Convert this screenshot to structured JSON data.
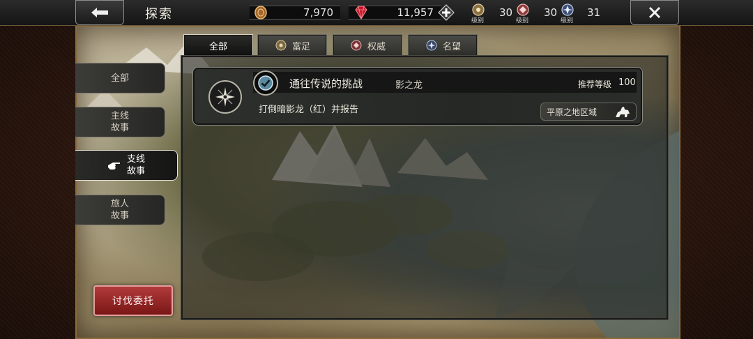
{
  "header": {
    "title": "探索",
    "back_icon": "arrow-left-icon",
    "close_icon": "close-icon"
  },
  "resources": {
    "coins": "7,970",
    "gems": "11,957",
    "add_icon": "plus-icon"
  },
  "ranks": [
    {
      "value": "30",
      "label": "级别",
      "icon": "wealth-emblem-icon"
    },
    {
      "value": "30",
      "label": "级别",
      "icon": "authority-emblem-icon"
    },
    {
      "value": "31",
      "label": "级别",
      "icon": "fame-emblem-icon"
    }
  ],
  "tabs": [
    {
      "label": "全部",
      "active": true
    },
    {
      "label": "富足",
      "icon": "wealth-emblem-icon"
    },
    {
      "label": "权威",
      "icon": "authority-emblem-icon"
    },
    {
      "label": "名望",
      "icon": "fame-emblem-icon"
    }
  ],
  "sidebar": {
    "items": [
      {
        "label": "全部"
      },
      {
        "label_line1": "主线",
        "label_line2": "故事"
      },
      {
        "label_line1": "支线",
        "label_line2": "故事",
        "active": true
      },
      {
        "label_line1": "旅人",
        "label_line2": "故事"
      }
    ],
    "hunt_button": "讨伐委托"
  },
  "quest": {
    "title": "通往传说的挑战",
    "target": "影之龙",
    "recommended_label": "推荐等级",
    "recommended_level": "100",
    "description": "打倒暗影龙（红）并报告",
    "region": "平原之地区域",
    "completed": true
  },
  "colors": {
    "hunt_button": "#9a2626",
    "panel_bg": "#1c1e1c",
    "accent_text": "#f2efe6"
  }
}
